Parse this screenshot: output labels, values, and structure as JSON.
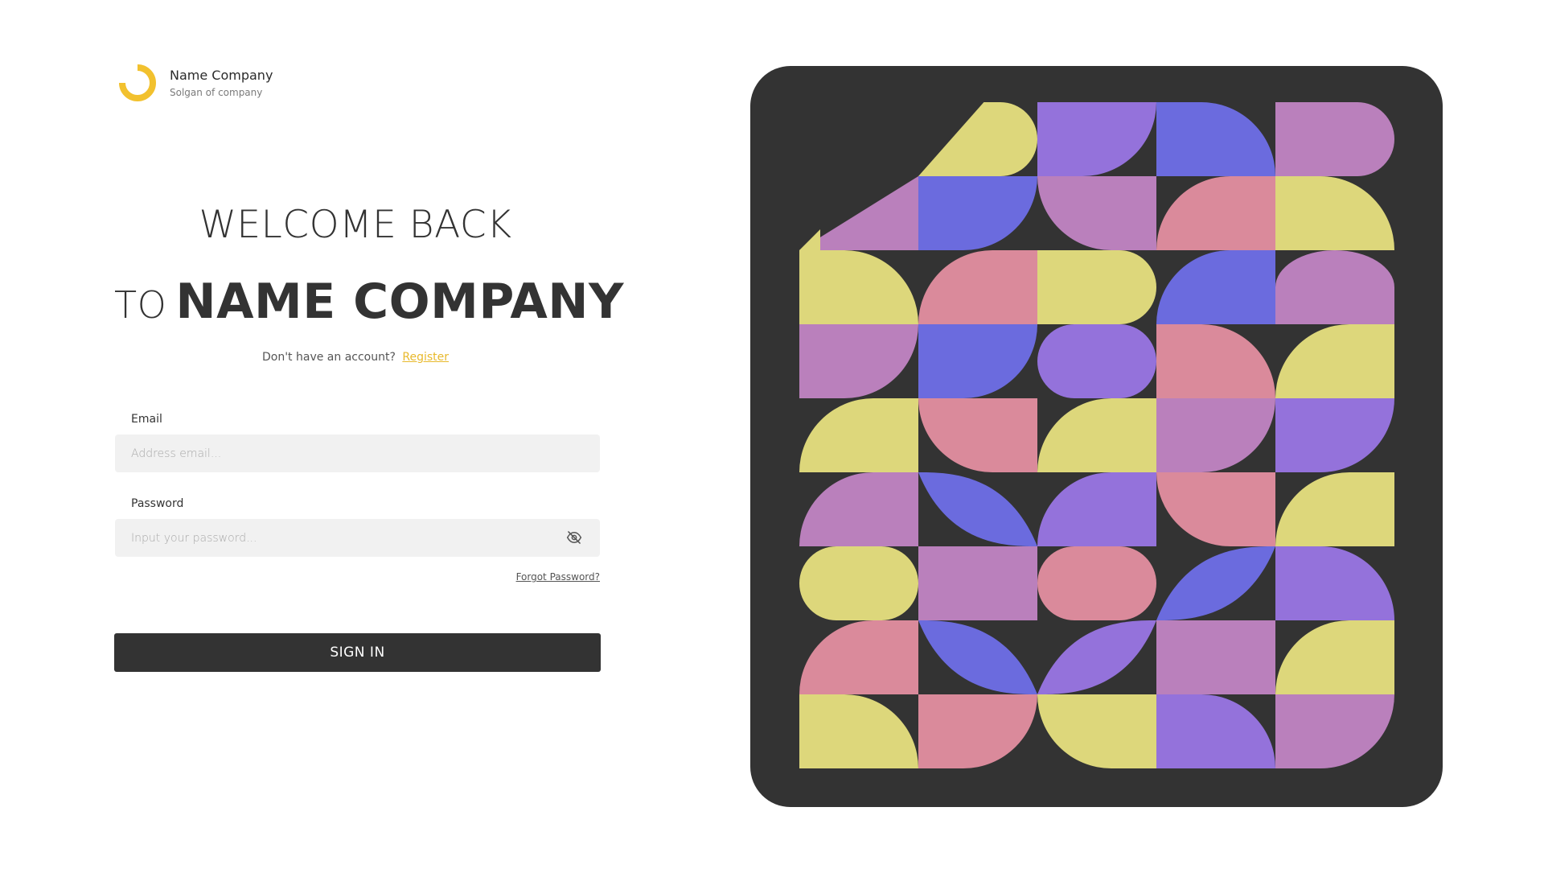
{
  "brand": {
    "name": "Name Company",
    "slogan": "Solgan of company",
    "logo_icon": "ring-logo-icon",
    "accent_color": "#F2C12E"
  },
  "welcome": {
    "line1": "WELCOME BACK",
    "line2_prefix": "TO",
    "line2_company": "NAME COMPANY"
  },
  "register": {
    "prompt": "Don't have an account?",
    "link_label": "Register"
  },
  "form": {
    "email": {
      "label": "Email",
      "placeholder": "Address email..."
    },
    "password": {
      "label": "Password",
      "placeholder": "Input your password...",
      "toggle_icon": "eye-off-icon"
    },
    "forgot_label": "Forgot Password?",
    "submit_label": "SIGN IN"
  },
  "art": {
    "panel_color": "#333333",
    "palette": {
      "Y": "#DDD77B",
      "P": "#9472DB",
      "B": "#6B6BDE",
      "M": "#BA80BC",
      "K": "#DA8A9B"
    }
  }
}
